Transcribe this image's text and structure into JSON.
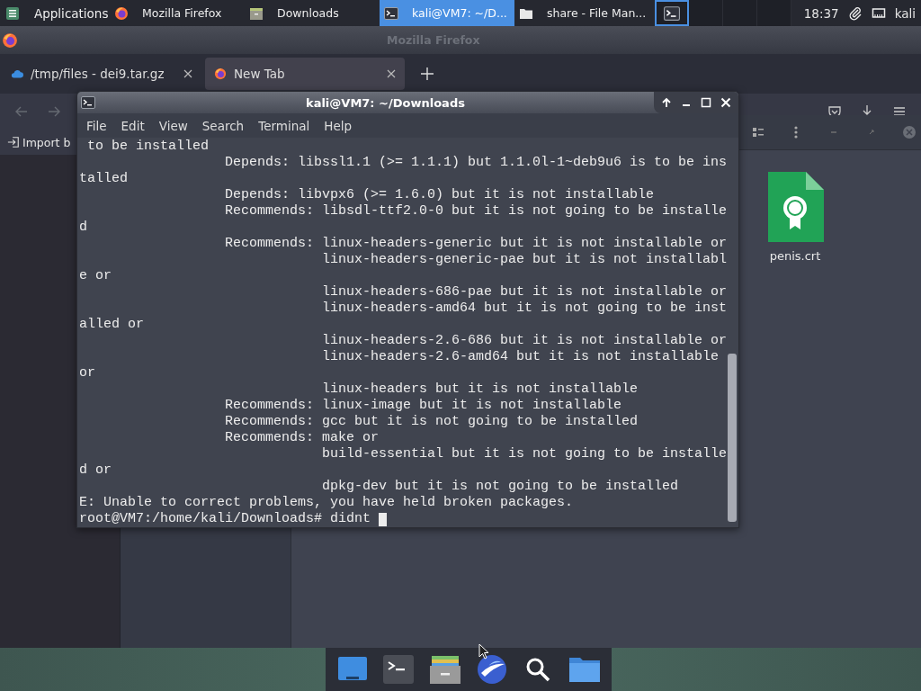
{
  "top_panel": {
    "applications_menu": "Applications",
    "tasks": [
      {
        "label": "Mozilla Firefox",
        "selected": false
      },
      {
        "label": "Downloads",
        "selected": false
      },
      {
        "label": "kali@VM7: ~/D...",
        "selected": true
      },
      {
        "label": "share - File Man...",
        "selected": false
      }
    ],
    "workspaces": [
      {
        "selected": true
      },
      {
        "selected": false
      },
      {
        "selected": false
      },
      {
        "selected": false
      }
    ],
    "clock": "18:37",
    "user": "kali"
  },
  "firefox": {
    "title": "Mozilla Firefox",
    "tabs": [
      {
        "label": "/tmp/files - dei9.tar.gz",
        "selected": false
      },
      {
        "label": "New Tab",
        "selected": true
      }
    ],
    "bookmark": "Import b"
  },
  "file_manager": {
    "files": [
      {
        "name": "penis.crt"
      }
    ]
  },
  "terminal": {
    "title": "kali@VM7: ~/Downloads",
    "menu": [
      "File",
      "Edit",
      "View",
      "Search",
      "Terminal",
      "Help"
    ],
    "lines": [
      " to be installed",
      "                  Depends: libssl1.1 (>= 1.1.1) but 1.1.0l-1~deb9u6 is to be ins",
      "talled",
      "                  Depends: libvpx6 (>= 1.6.0) but it is not installable",
      "                  Recommends: libsdl-ttf2.0-0 but it is not going to be installe",
      "d",
      "                  Recommends: linux-headers-generic but it is not installable or",
      "                              linux-headers-generic-pae but it is not installabl",
      "e or",
      "                              linux-headers-686-pae but it is not installable or",
      "                              linux-headers-amd64 but it is not going to be inst",
      "alled or",
      "                              linux-headers-2.6-686 but it is not installable or",
      "                              linux-headers-2.6-amd64 but it is not installable",
      "or",
      "                              linux-headers but it is not installable",
      "                  Recommends: linux-image but it is not installable",
      "                  Recommends: gcc but it is not going to be installed",
      "                  Recommends: make or",
      "                              build-essential but it is not going to be installe",
      "d or",
      "                              dpkg-dev but it is not going to be installed",
      "E: Unable to correct problems, you have held broken packages.",
      "root@VM7:/home/kali/Downloads# didnt"
    ]
  }
}
